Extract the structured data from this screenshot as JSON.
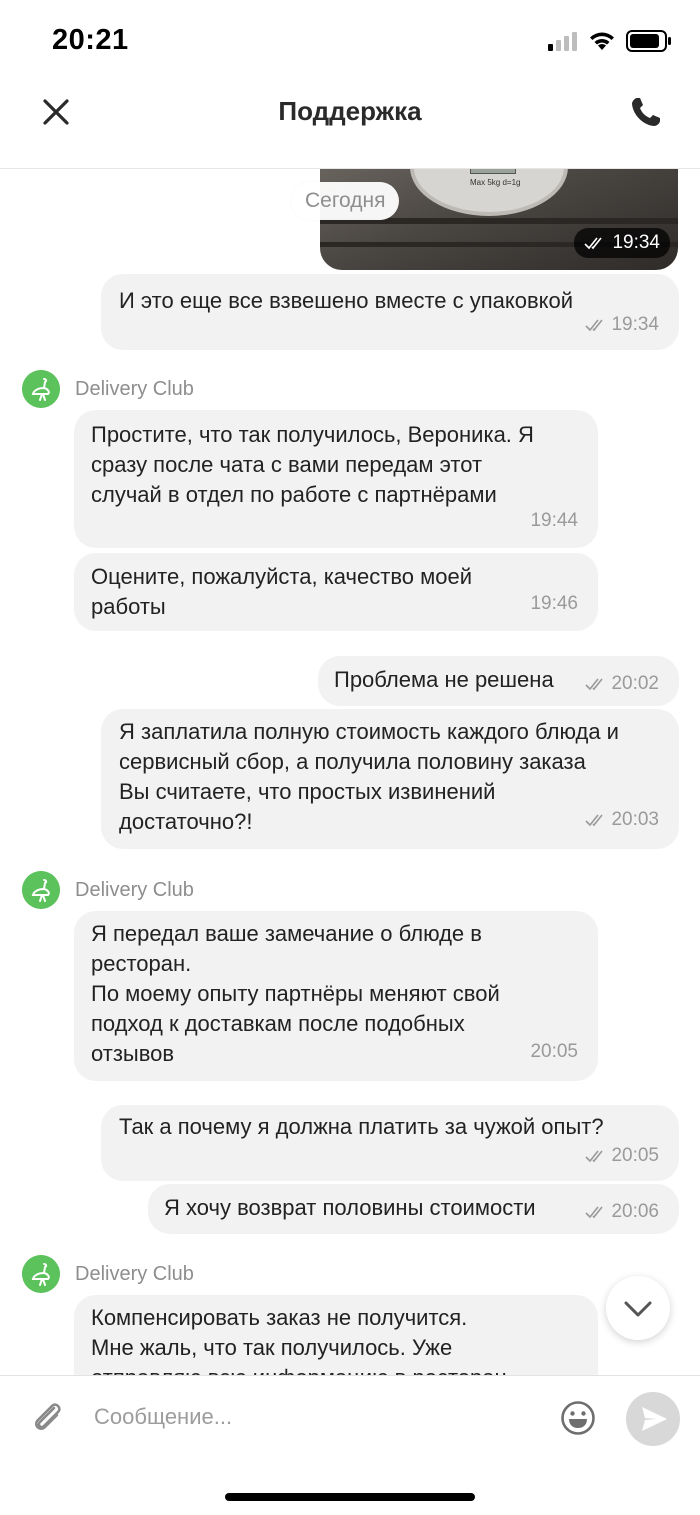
{
  "status_bar": {
    "time": "20:21"
  },
  "header": {
    "title": "Поддержка"
  },
  "chat": {
    "photo_message": {
      "time": "19:34",
      "scale_text": "Max 5kg d=1g"
    },
    "date_separator": "Сегодня",
    "messages": [
      {
        "text": "И это еще все взвешено вместе с упаковкой",
        "time": "19:34"
      },
      {
        "sender": "Delivery Club"
      },
      {
        "text": "Простите, что так получилось, Вероника. Я\nсразу после чата с вами передам этот\nслучай в отдел по работе с партнёрами",
        "time": "19:44"
      },
      {
        "text": "Оцените, пожалуйста, качество моей\nработы",
        "time": "19:46"
      },
      {
        "text": "Проблема не решена",
        "time": "20:02"
      },
      {
        "text": "Я заплатила полную стоимость каждого блюда и\nсервисный сбор, а получила половину заказа\nВы считаете, что простых извинений\nдостаточно?!",
        "time": "20:03"
      },
      {
        "sender": "Delivery Club"
      },
      {
        "text": "Я передал ваше замечание о блюде в\nресторан.\nПо моему опыту партнёры меняют свой\nподход к доставкам после подобных\nотзывов",
        "time": "20:05"
      },
      {
        "text": "Так а почему я должна платить за чужой опыт?",
        "time": "20:05"
      },
      {
        "text": "Я хочу возврат половины стоимости",
        "time": "20:06"
      },
      {
        "sender": "Delivery Club"
      },
      {
        "text": "Компенсировать заказ не получится.\nМне жаль, что так получилось. Уже\nотправляю всю информацию в ресторан"
      }
    ]
  },
  "composer": {
    "placeholder": "Сообщение..."
  },
  "colors": {
    "avatar_green": "#5cc25c",
    "bubble_bg": "#f2f2f2",
    "time_gray": "#9a9a9a"
  },
  "icons": [
    "close-icon",
    "phone-icon",
    "read-ticks-icon",
    "ostrich-icon",
    "chevron-down-icon",
    "paperclip-icon",
    "emoji-icon",
    "send-icon"
  ]
}
